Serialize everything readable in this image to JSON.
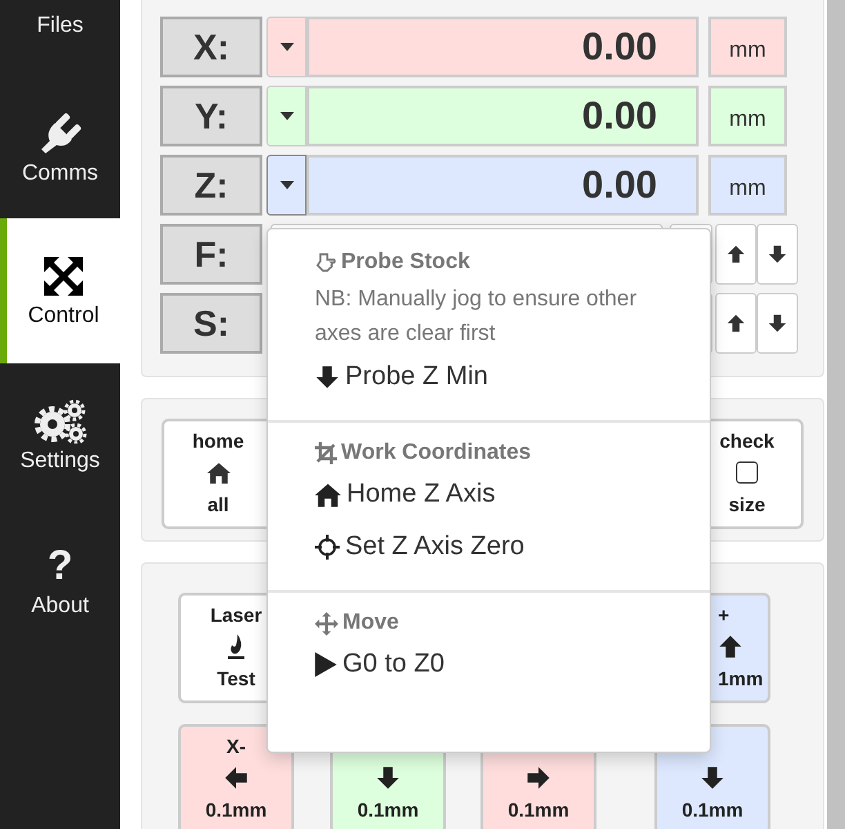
{
  "sidebar": {
    "items": [
      {
        "label": "Files",
        "selected": false
      },
      {
        "label": "Comms",
        "selected": false
      },
      {
        "label": "Control",
        "selected": true
      },
      {
        "label": "Settings",
        "selected": false
      },
      {
        "label": "About",
        "selected": false,
        "glyph": "?"
      }
    ]
  },
  "axes": [
    {
      "kind": "position",
      "label": "X:",
      "color": "#ffdddd",
      "expanded": false,
      "value": "0.00",
      "unit": "mm"
    },
    {
      "kind": "position",
      "label": "Y:",
      "color": "#ddffdd",
      "expanded": false,
      "value": "0.00",
      "unit": "mm"
    },
    {
      "kind": "position",
      "label": "Z:",
      "color": "#dde8ff",
      "expanded": true,
      "value": "0.00",
      "unit": "mm"
    },
    {
      "kind": "rate",
      "label": "F:"
    },
    {
      "kind": "rate",
      "label": "S:"
    }
  ],
  "actions": [
    {
      "kind": "home",
      "top": "home",
      "bottom": "all"
    },
    {
      "kind": "check",
      "top": "check",
      "bottom": "size",
      "checked": false
    }
  ],
  "jog_rows": [
    [
      {
        "kind": "laser",
        "top": "Laser",
        "bottom": "Test",
        "color": "#ffffff"
      },
      null,
      null,
      {
        "kind": "up",
        "top": "+",
        "bottom": "1mm",
        "color": "#dde8ff"
      }
    ],
    [
      {
        "kind": "left",
        "top": "X-",
        "bottom": "0.1mm",
        "color": "#ffdddd"
      },
      {
        "kind": "down",
        "bottom": "0.1mm",
        "color": "#ddffdd"
      },
      {
        "kind": "right",
        "bottom": "0.1mm",
        "color": "#ffdddd"
      },
      {
        "kind": "down",
        "bottom": "0.1mm",
        "color": "#dde8ff"
      }
    ]
  ],
  "menu": {
    "sections": [
      {
        "kind": "probe",
        "heading": "Probe Stock",
        "note": "NB: Manually jog to ensure other axes are clear first",
        "items": [
          {
            "kind": "down",
            "label": "Probe Z Min"
          }
        ]
      },
      {
        "kind": "crop",
        "heading": "Work Coordinates",
        "items": [
          {
            "kind": "home",
            "label": "Home Z Axis"
          },
          {
            "kind": "crosshair",
            "label": "Set Z Axis Zero"
          }
        ]
      },
      {
        "kind": "move",
        "heading": "Move",
        "items": [
          {
            "kind": "play",
            "label": "G0 to Z0"
          }
        ]
      }
    ]
  }
}
